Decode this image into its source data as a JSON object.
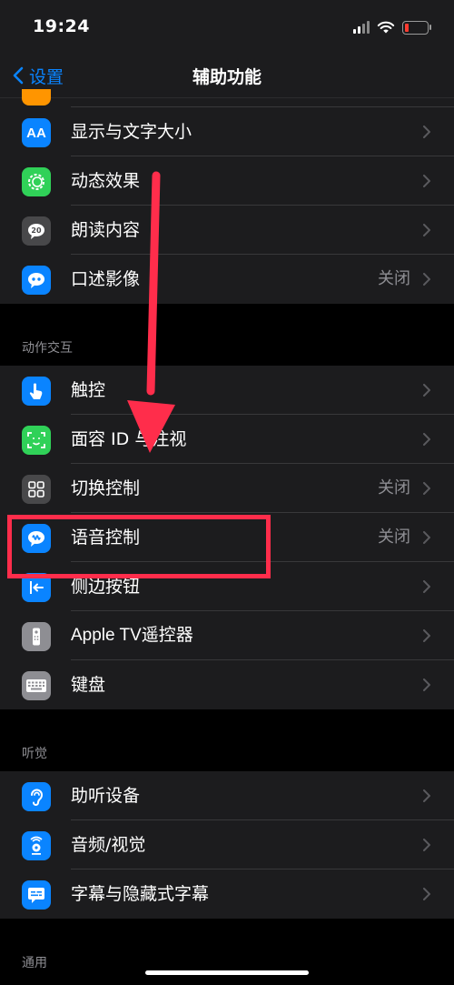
{
  "status": {
    "time": "19:24"
  },
  "nav": {
    "back_label": "设置",
    "title": "辅助功能"
  },
  "sections": {
    "vision_items": [
      {
        "label": "显示与文字大小",
        "value": ""
      },
      {
        "label": "动态效果",
        "value": ""
      },
      {
        "label": "朗读内容",
        "value": ""
      },
      {
        "label": "口述影像",
        "value": "关闭"
      }
    ],
    "interaction": {
      "header": "动作交互",
      "items": [
        {
          "label": "触控",
          "value": ""
        },
        {
          "label": "面容 ID 与注视",
          "value": ""
        },
        {
          "label": "切换控制",
          "value": "关闭"
        },
        {
          "label": "语音控制",
          "value": "关闭"
        },
        {
          "label": "侧边按钮",
          "value": ""
        },
        {
          "label": "Apple TV遥控器",
          "value": ""
        },
        {
          "label": "键盘",
          "value": ""
        }
      ]
    },
    "hearing": {
      "header": "听觉",
      "items": [
        {
          "label": "助听设备",
          "value": ""
        },
        {
          "label": "音频/视觉",
          "value": ""
        },
        {
          "label": "字幕与隐藏式字幕",
          "value": ""
        }
      ]
    },
    "general": {
      "header": "通用"
    }
  },
  "icons": {
    "display_text_size": "aa-text-icon",
    "motion": "motion-circle-icon",
    "spoken_content": "speech-bubble-icon",
    "audio_descriptions": "quote-bubble-icon",
    "touch": "hand-touch-icon",
    "face_id": "face-id-icon",
    "switch_control": "grid-icon",
    "voice_control": "voice-bubble-icon",
    "side_button": "side-arrow-icon",
    "apple_tv_remote": "remote-icon",
    "keyboard": "keyboard-icon",
    "hearing_devices": "ear-icon",
    "audio_visual": "speaker-icon",
    "subtitles": "captions-icon"
  },
  "colors": {
    "accent": "#0a84ff",
    "annotation": "#ff2d4b",
    "blue_icon": "#0a84ff",
    "green_icon": "#30d158",
    "gray_icon": "#48484a"
  }
}
